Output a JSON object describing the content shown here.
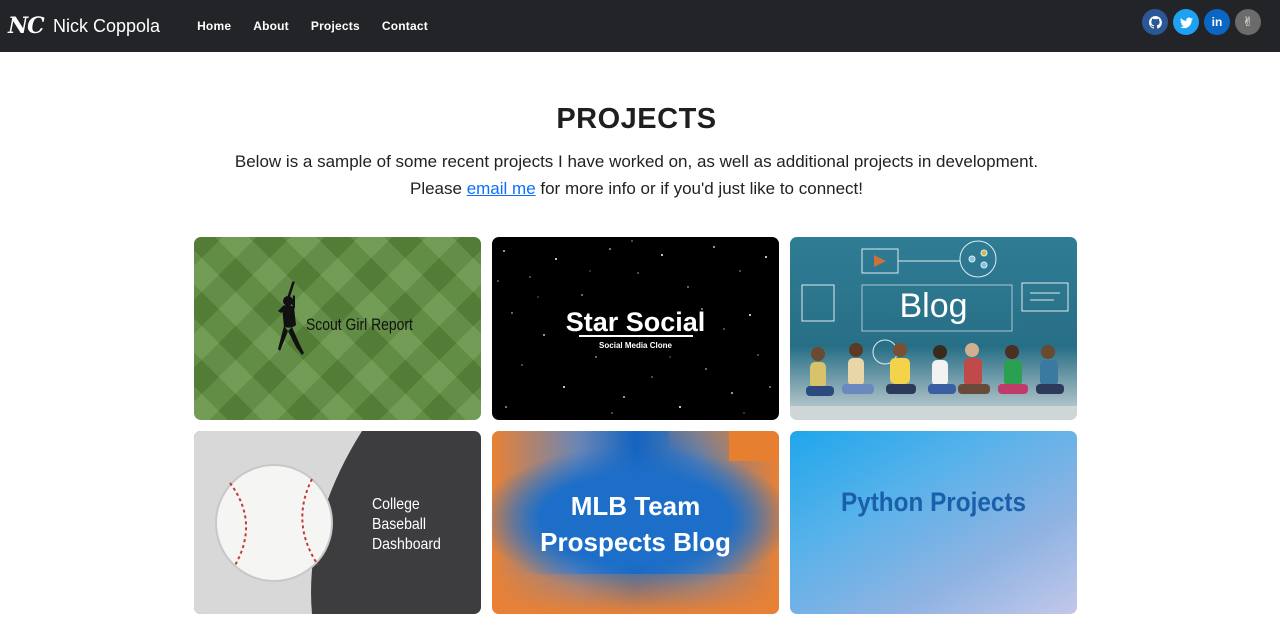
{
  "nav": {
    "logo": "NC",
    "name": "Nick Coppola",
    "links": [
      "Home",
      "About",
      "Projects",
      "Contact"
    ],
    "social": [
      {
        "icon": "github-icon",
        "glyph": "◉",
        "color": "#2b5797"
      },
      {
        "icon": "twitter-icon",
        "glyph": "✈",
        "color": "#1da1f2"
      },
      {
        "icon": "linkedin-icon",
        "glyph": "in",
        "color": "#0a66c2"
      },
      {
        "icon": "kofi-icon",
        "glyph": "✌",
        "color": "#6b6b6b"
      }
    ]
  },
  "main": {
    "title": "PROJECTS",
    "intro_line1": "Below is a sample of some recent projects I have worked on, as well as additional projects in development.",
    "intro_pre": "Please ",
    "intro_link": "email me",
    "intro_post": " for more info or if you'd just like to connect!"
  },
  "projects": [
    {
      "title": "Scout Girl Report"
    },
    {
      "title": "Star Social",
      "subtitle": "Social Media Clone"
    },
    {
      "title": "Blog"
    },
    {
      "lines": [
        "College",
        "Baseball",
        "Dashboard"
      ]
    },
    {
      "lines": [
        "MLB Team",
        "Prospects Blog"
      ]
    },
    {
      "title": "Python Projects"
    }
  ]
}
